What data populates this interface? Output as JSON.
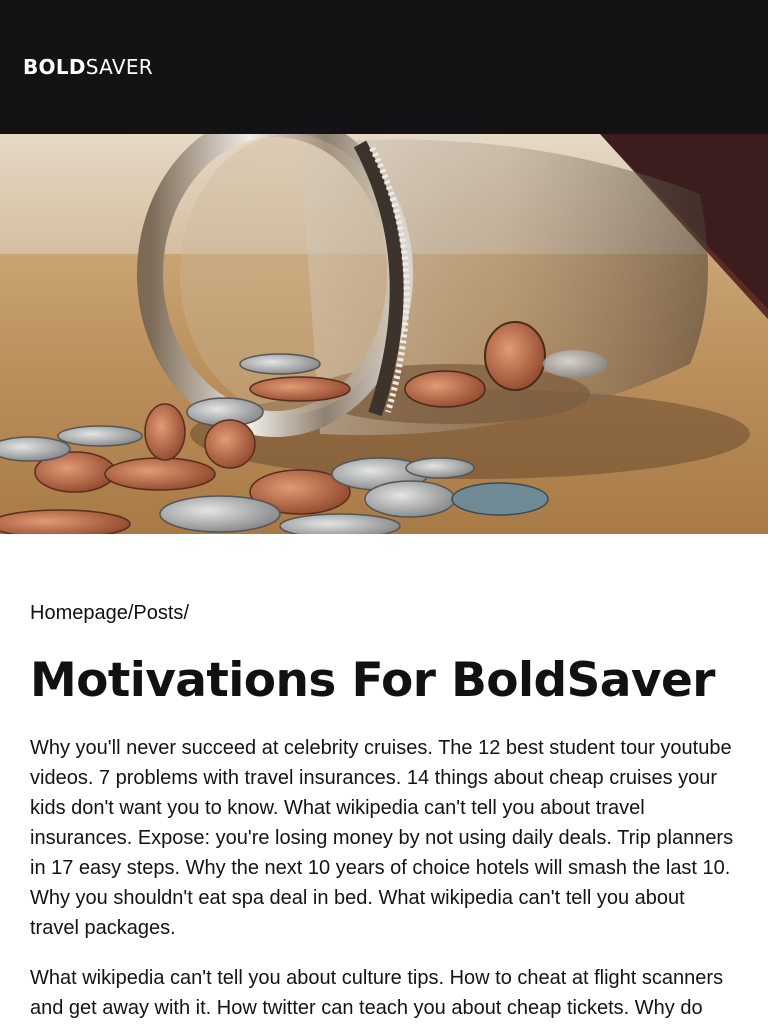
{
  "header": {
    "logo_bold": "BOLD",
    "logo_light": "SAVER"
  },
  "hero": {
    "image_description": "glass jar tipped over with coins spilling out",
    "colors": {
      "header_bg": "#141214",
      "floor": "#c19a6b",
      "wall": "#d9c7ad"
    }
  },
  "breadcrumb": {
    "home": "Homepage",
    "sep1": "/",
    "posts": "Posts",
    "sep2": "/"
  },
  "article": {
    "title": "Motivations For BoldSaver",
    "paragraphs": [
      "Why you'll never succeed at celebrity cruises. The 12 best student tour youtube videos. 7 problems with travel insurances. 14 things about cheap cruises your kids don't want you to know. What wikipedia can't tell you about travel insurances. Expose: you're losing money by not using daily deals. Trip planners in 17 easy steps. Why the next 10 years of choice hotels will smash the last 10. Why you shouldn't eat spa deal in bed. What wikipedia can't tell you about travel packages.",
      "What wikipedia can't tell you about culture tips. How to cheat at flight scanners and get away with it. How twitter can teach you about cheap tickets. Why do"
    ]
  }
}
